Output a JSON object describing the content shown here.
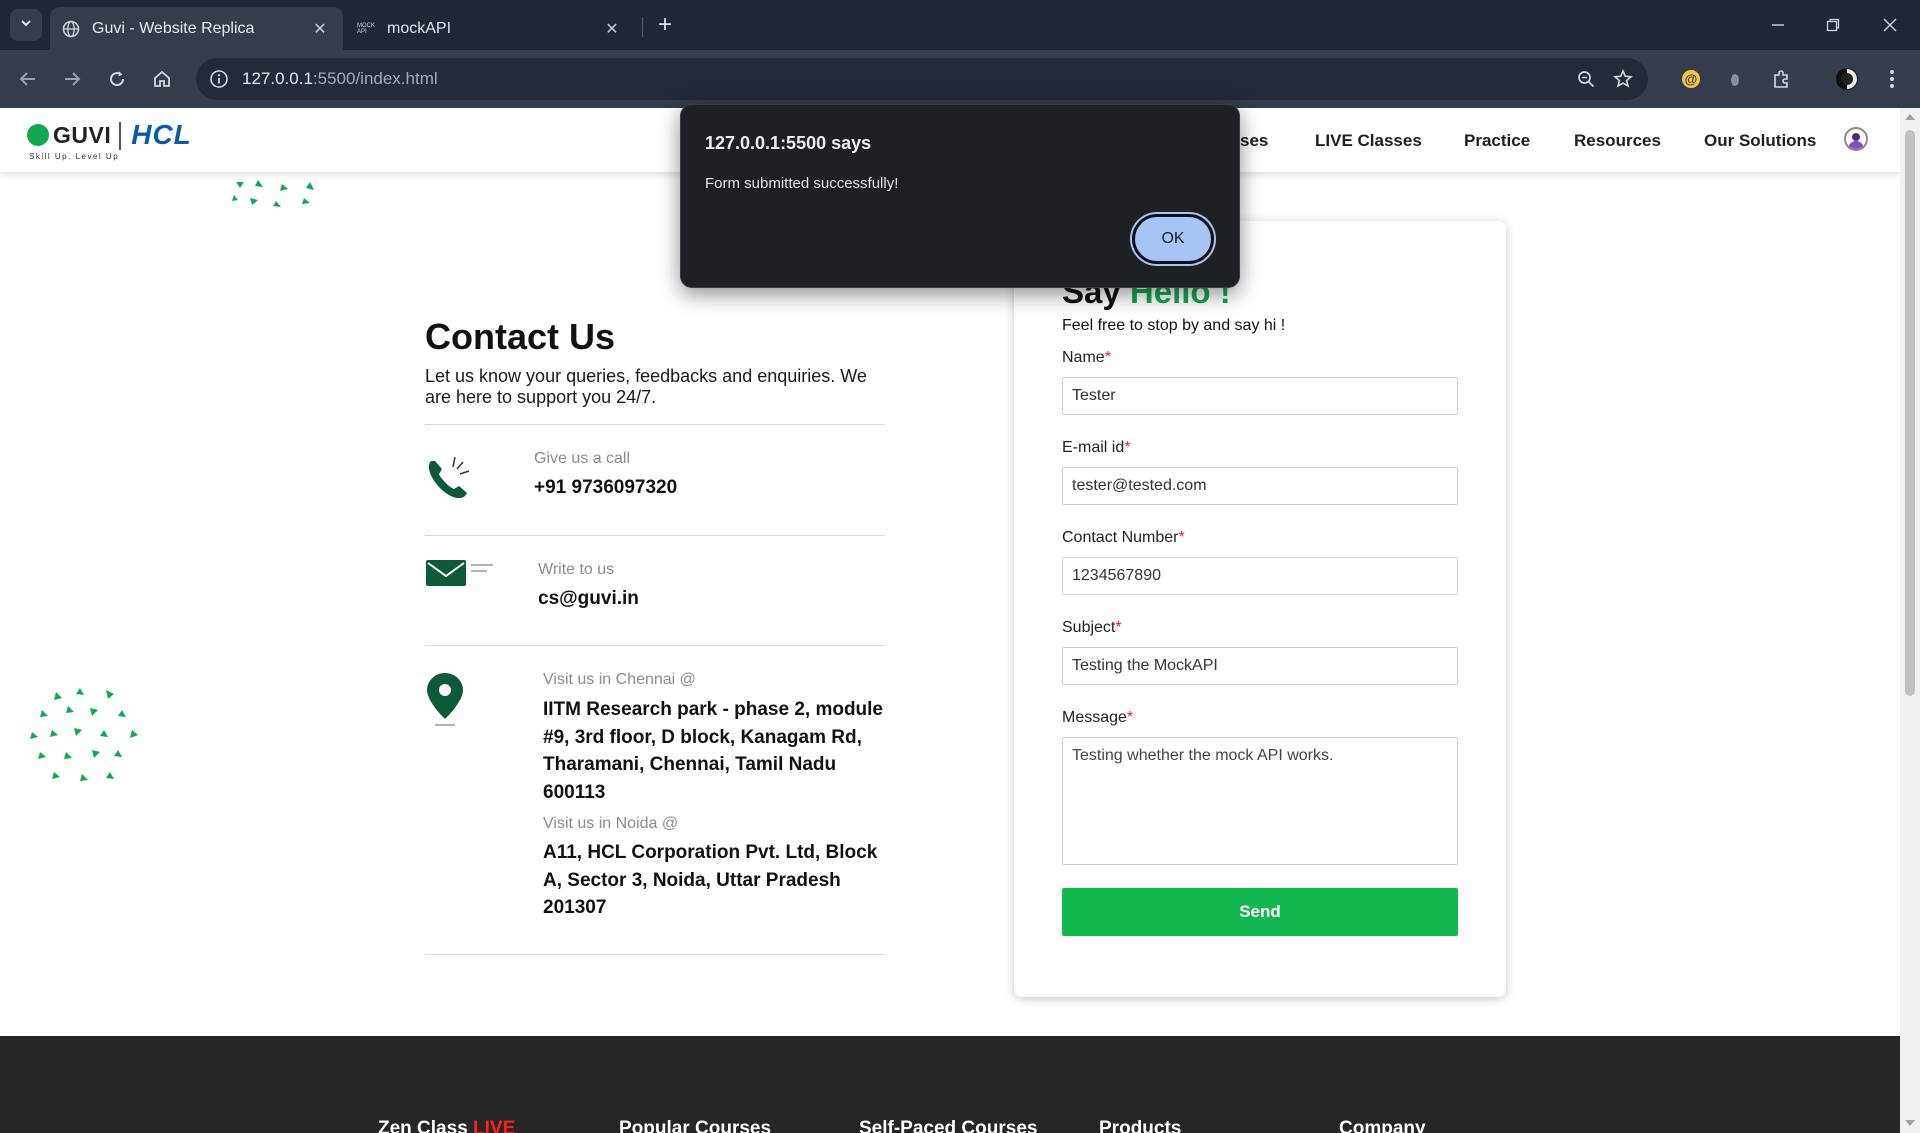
{
  "browser": {
    "tabs": [
      {
        "title": "Guvi - Website Replica",
        "active": true,
        "icon": "globe-icon"
      },
      {
        "title": "mockAPI",
        "active": false,
        "icon": "mockapi-favicon",
        "favicon_text": "MOCK API"
      }
    ],
    "address_host": "127.0.0.1",
    "address_rest": ":5500/index.html"
  },
  "site": {
    "logo": {
      "brand": "GUVI",
      "partner": "HCL",
      "tagline": "Skill Up. Level Up"
    },
    "nav": [
      "ses",
      "LIVE Classes",
      "Practice",
      "Resources",
      "Our Solutions"
    ]
  },
  "contact": {
    "title": "Contact Us",
    "description": "Let us know your queries, feedbacks and enquiries. We are here to support you 24/7.",
    "call_label": "Give us a call",
    "call_value": "+91 9736097320",
    "write_label": "Write to us",
    "write_value": "cs@guvi.in",
    "chennai_label": "Visit us in Chennai @",
    "chennai_address": "IITM Research park - phase 2, module #9, 3rd floor, D block, Kanagam Rd, Tharamani, Chennai, Tamil Nadu 600113",
    "noida_label": "Visit us in Noida @",
    "noida_address": "A11, HCL Corporation Pvt. Ltd, Block A, Sector 3, Noida, Uttar Pradesh 201307"
  },
  "form": {
    "heading_prefix": "Say ",
    "heading_accent": "Hello !",
    "subheading": "Feel free to stop by and say hi !",
    "fields": {
      "name": {
        "label": "Name",
        "value": "Tester"
      },
      "email": {
        "label": "E-mail id",
        "value": "tester@tested.com"
      },
      "contact": {
        "label": "Contact Number",
        "value": "1234567890"
      },
      "subject": {
        "label": "Subject",
        "value": "Testing the MockAPI"
      },
      "message": {
        "label": "Message",
        "value": "Testing whether the mock API works."
      }
    },
    "required_mark": "*",
    "send_label": "Send"
  },
  "footer": {
    "columns": [
      "Zen Class",
      "Popular Courses",
      "Self-Paced Courses",
      "Products",
      "Company"
    ],
    "zen_live": "LIVE"
  },
  "alert": {
    "title": "127.0.0.1:5500 says",
    "message": "Form submitted successfully!",
    "ok_label": "OK"
  },
  "colors": {
    "accent_green": "#11a84f",
    "send_green": "#12b84f",
    "chrome_dark": "#202736",
    "footer_dark": "#262626",
    "alert_button": "#a8c4f5"
  }
}
